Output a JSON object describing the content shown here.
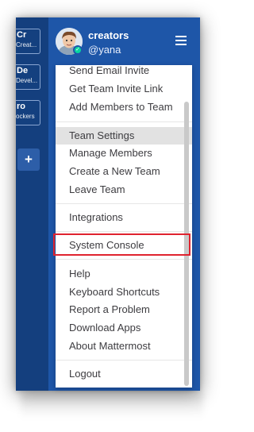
{
  "teams": [
    {
      "abbr": "Cr",
      "subtitle": "Creat..."
    },
    {
      "abbr": "De",
      "subtitle": "Devel..."
    },
    {
      "abbr": "ro",
      "subtitle": "ockers"
    }
  ],
  "add_team_label": "+",
  "header": {
    "team_name": "creators",
    "username": "@yana"
  },
  "menu": {
    "items": [
      "Send Email Invite",
      "Get Team Invite Link",
      "Add Members to Team",
      "Team Settings",
      "Manage Members",
      "Create a New Team",
      "Leave Team",
      "Integrations",
      "System Console",
      "Help",
      "Keyboard Shortcuts",
      "Report a Problem",
      "Download Apps",
      "About Mattermost",
      "Logout"
    ],
    "active_item": "Team Settings",
    "highlighted_item": "System Console"
  },
  "colors": {
    "sidebar": "#143f7e",
    "header": "#1e56a8",
    "status": "#06d6a0",
    "highlight_border": "#e0232f"
  },
  "icons": [
    "avatar",
    "online-status-icon",
    "hamburger-menu-icon",
    "add-team-icon"
  ]
}
